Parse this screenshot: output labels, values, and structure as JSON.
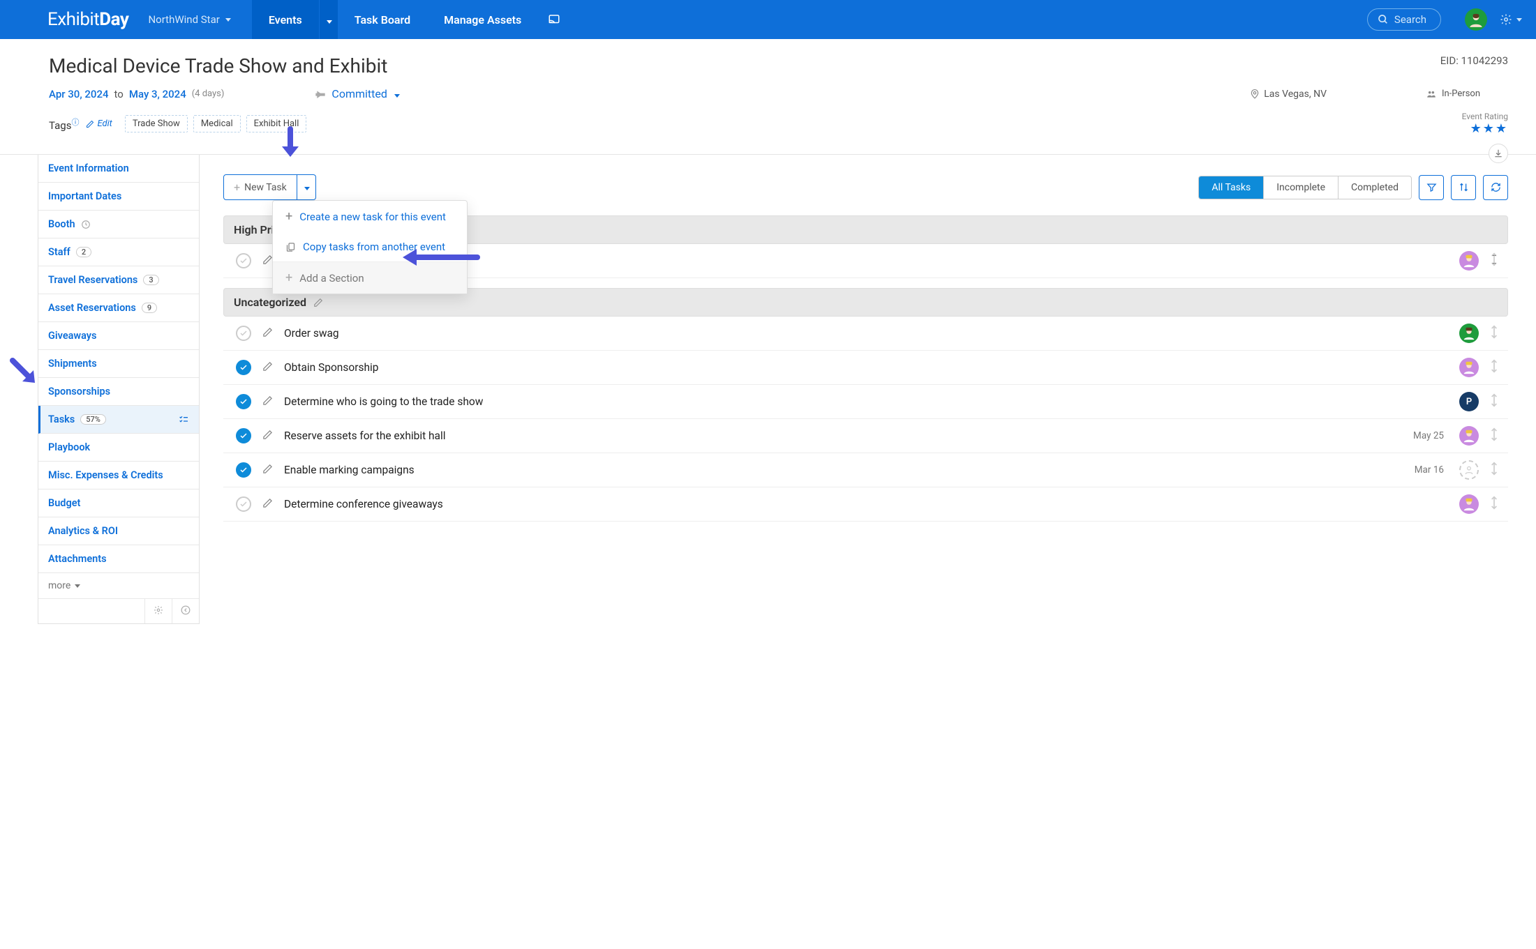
{
  "topnav": {
    "logo_prefix": "Exhibit",
    "logo_suffix": "Day",
    "workspace": "NorthWind Star",
    "items": [
      "Events",
      "Task Board",
      "Manage Assets"
    ],
    "search_label": "Search"
  },
  "event": {
    "title": "Medical Device Trade Show and Exhibit",
    "eid_label": "EID: 11042293",
    "start_date": "Apr 30, 2024",
    "to_label": "to",
    "end_date": "May 3, 2024",
    "days": "(4 days)",
    "status": "Committed",
    "location": "Las Vegas, NV",
    "format": "In-Person",
    "tags_label": "Tags",
    "edit_label": "Edit",
    "tags": [
      "Trade Show",
      "Medical",
      "Exhibit Hall"
    ],
    "rating_label": "Event Rating"
  },
  "sidebar": {
    "items": [
      {
        "label": "Event Information"
      },
      {
        "label": "Important Dates"
      },
      {
        "label": "Booth",
        "icon": "clock"
      },
      {
        "label": "Staff",
        "badge": "2"
      },
      {
        "label": "Travel Reservations",
        "badge": "3"
      },
      {
        "label": "Asset Reservations",
        "badge": "9"
      },
      {
        "label": "Giveaways"
      },
      {
        "label": "Shipments"
      },
      {
        "label": "Sponsorships"
      },
      {
        "label": "Tasks",
        "badge": "57%",
        "active": true,
        "icon": "tasks"
      },
      {
        "label": "Playbook"
      },
      {
        "label": "Misc. Expenses & Credits"
      },
      {
        "label": "Budget"
      },
      {
        "label": "Analytics & ROI"
      },
      {
        "label": "Attachments"
      }
    ],
    "more_label": "more"
  },
  "toolbar": {
    "new_task": "New Task",
    "filters": [
      "All Tasks",
      "Incomplete",
      "Completed"
    ]
  },
  "dropdown": {
    "create": "Create a new task for this event",
    "copy": "Copy tasks from another event",
    "add_section": "Add a Section"
  },
  "sections": [
    {
      "name": "High Priority"
    },
    {
      "name": "Uncategorized"
    }
  ],
  "tasks_high": [
    {
      "title": "",
      "done": false,
      "assignee_color": "#c98ae0"
    }
  ],
  "tasks_uncat": [
    {
      "title": "Order swag",
      "done": false,
      "assignee_color": "#1e9c3c"
    },
    {
      "title": "Obtain Sponsorship",
      "done": true,
      "assignee_color": "#c98ae0"
    },
    {
      "title": "Determine who is going to the trade show",
      "done": true,
      "assignee_color": "#163b66",
      "assignee_letter": "P"
    },
    {
      "title": "Reserve assets for the exhibit hall",
      "done": true,
      "date": "May 25",
      "assignee_color": "#c98ae0"
    },
    {
      "title": "Enable marking campaigns",
      "done": true,
      "date": "Mar 16",
      "assignee_color": "",
      "unassigned": true
    },
    {
      "title": "Determine conference giveaways",
      "done": false,
      "assignee_color": "#c98ae0"
    }
  ]
}
